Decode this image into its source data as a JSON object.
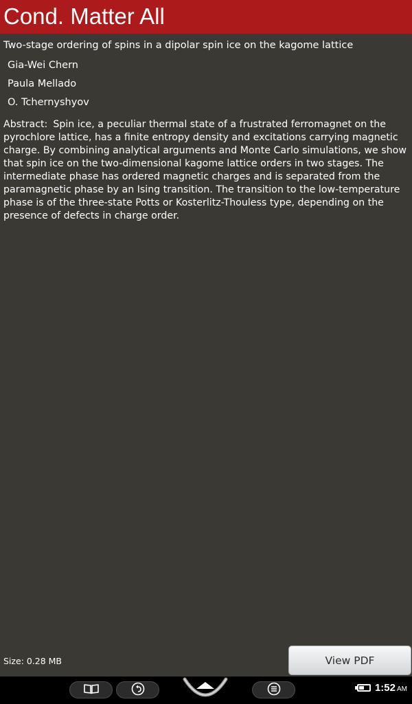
{
  "app": {
    "title": "Cond. Matter All",
    "accent_color": "#ad1a1c",
    "background_color": "#3a3934"
  },
  "paper": {
    "title": "Two-stage ordering of spins in a dipolar spin ice on the kagome lattice",
    "authors": [
      "Gia-Wei Chern",
      "Paula Mellado",
      "O. Tchernyshyov"
    ],
    "abstract_label": "Abstract:",
    "abstract": "Spin ice, a peculiar thermal state of a frustrated ferromagnet on the pyrochlore lattice, has a finite entropy density and excitations carrying magnetic charge. By combining analytical arguments and Monte Carlo simulations, we show that spin ice on the two-dimensional kagome lattice orders in two stages. The intermediate phase has ordered magnetic charges and is separated from the paramagnetic phase by an Ising transition. The transition to the low-temperature phase is of the three-state Potts or Kosterlitz-Thouless type, depending on the presence of defects in charge order.",
    "size_text": "Size: 0.28 MB"
  },
  "actions": {
    "view_pdf_label": "View PDF"
  },
  "system_bar": {
    "nav_icons": [
      "book-icon",
      "back-icon",
      "home-icon",
      "menu-icon"
    ],
    "battery_level": 0.5,
    "time": "1:52",
    "ampm": "AM"
  }
}
